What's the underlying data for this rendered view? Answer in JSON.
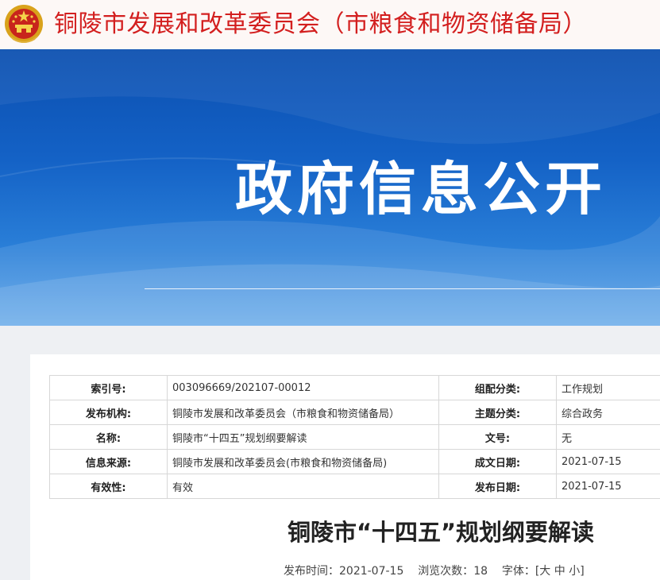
{
  "header": {
    "site_title": "铜陵市发展和改革委员会（市粮食和物资储备局）"
  },
  "banner": {
    "title": "政府信息公开"
  },
  "metadata": {
    "rows": [
      {
        "label1": "索引号:",
        "value1": "003096669/202107-00012",
        "label2": "组配分类:",
        "value2": "工作规划"
      },
      {
        "label1": "发布机构:",
        "value1": "铜陵市发展和改革委员会（市粮食和物资储备局）",
        "label2": "主题分类:",
        "value2": "综合政务"
      },
      {
        "label1": "名称:",
        "value1": "铜陵市“十四五”规划纲要解读",
        "label2": "文号:",
        "value2": "无"
      },
      {
        "label1": "信息来源:",
        "value1": "铜陵市发展和改革委员会(市粮食和物资储备局)",
        "label2": "成文日期:",
        "value2": "2021-07-15"
      },
      {
        "label1": "有效性:",
        "value1": "有效",
        "label2": "发布日期:",
        "value2": "2021-07-15"
      }
    ]
  },
  "article": {
    "title": "铜陵市“十四五”规划纲要解读",
    "publish_label": "发布时间：",
    "publish_date": "2021-07-15",
    "views_label": "浏览次数：",
    "views": "18",
    "font_label": "字体：",
    "font_open": "[",
    "font_large": "大",
    "font_medium": "中",
    "font_small": "小",
    "font_close": "]"
  },
  "colors": {
    "title_red": "#d31f1f",
    "banner_blue": "#1462c6"
  },
  "icons": {
    "emblem": "national-emblem-icon"
  }
}
